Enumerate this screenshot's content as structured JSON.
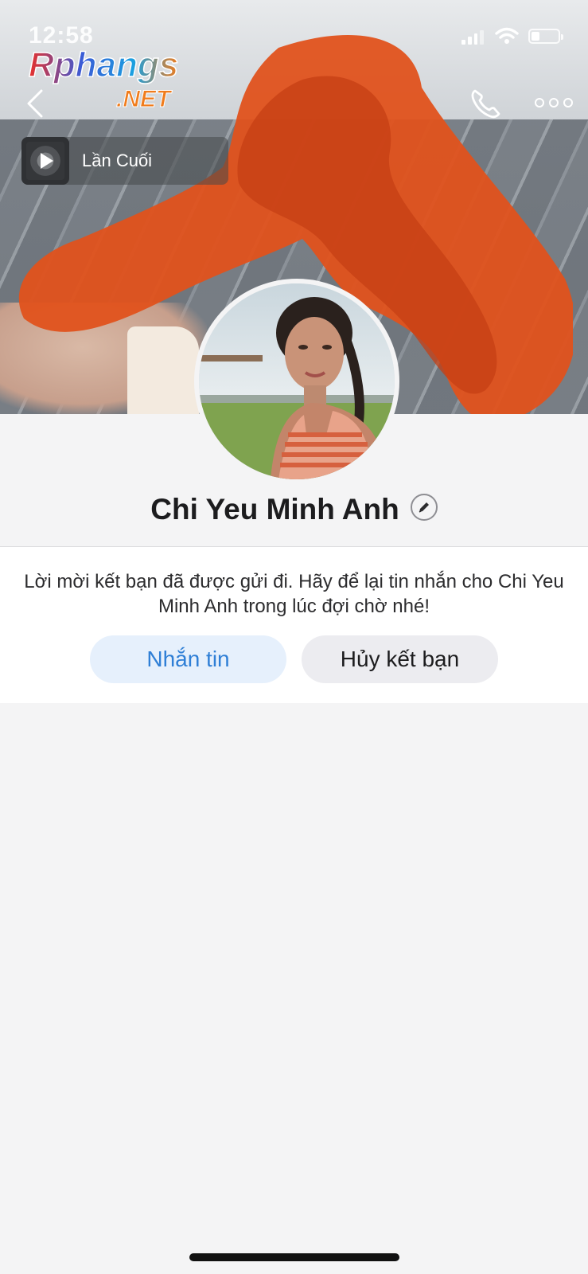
{
  "status_bar": {
    "time": "12:58"
  },
  "watermark": {
    "line1": "Rphangs",
    "line2": ".NET"
  },
  "nav": {
    "back_icon": "chevron-left-icon",
    "call_icon": "phone-icon",
    "more_icon": "more-horizontal-icon"
  },
  "music": {
    "label": "Lần Cuối"
  },
  "profile": {
    "name": "Chi Yeu Minh Anh"
  },
  "request_card": {
    "message": "Lời mời kết bạn đã được gửi đi. Hãy để lại tin nhắn cho Chi Yeu Minh Anh trong lúc đợi chờ nhé!",
    "message_button": "Nhắn tin",
    "unfriend_button": "Hủy kết bạn"
  },
  "colors": {
    "accent_blue": "#2f7fd6",
    "message_button_bg": "#e6f0fc",
    "secondary_button_bg": "#ececf0",
    "page_bg": "#f4f4f5",
    "blot_orange": "#e0521c"
  }
}
